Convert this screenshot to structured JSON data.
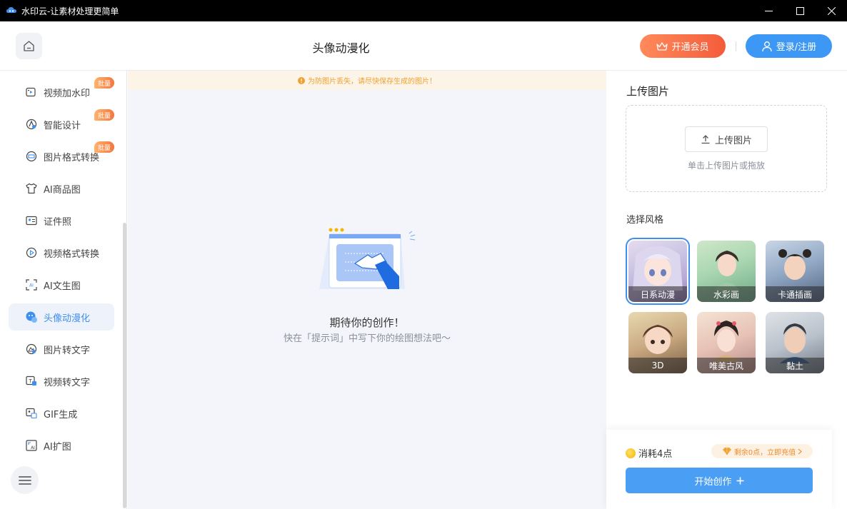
{
  "window": {
    "title": "水印云-让素材处理更简单",
    "controls": [
      "minimize-icon",
      "maximize-icon",
      "close-icon"
    ]
  },
  "header": {
    "title": "头像动漫化",
    "vip_label": "开通会员",
    "login_label": "登录/注册"
  },
  "sidebar": {
    "items": [
      {
        "label": "视频加水印",
        "icon": "video-watermark-icon",
        "badge": "批量",
        "active": false
      },
      {
        "label": "智能设计",
        "icon": "smart-design-icon",
        "badge": "批量",
        "active": false
      },
      {
        "label": "图片格式转换",
        "icon": "image-format-icon",
        "badge": "批量",
        "active": false
      },
      {
        "label": "AI商品图",
        "icon": "tshirt-icon",
        "badge": "",
        "active": false
      },
      {
        "label": "证件照",
        "icon": "id-photo-icon",
        "badge": "",
        "active": false
      },
      {
        "label": "视频格式转换",
        "icon": "video-format-icon",
        "badge": "",
        "active": false
      },
      {
        "label": "AI文生图",
        "icon": "text-to-image-icon",
        "badge": "",
        "active": false
      },
      {
        "label": "头像动漫化",
        "icon": "avatar-anime-icon",
        "badge": "",
        "active": true
      },
      {
        "label": "图片转文字",
        "icon": "image-to-text-icon",
        "badge": "",
        "active": false
      },
      {
        "label": "视频转文字",
        "icon": "video-to-text-icon",
        "badge": "",
        "active": false
      },
      {
        "label": "GIF生成",
        "icon": "gif-icon",
        "badge": "",
        "active": false
      },
      {
        "label": "AI扩图",
        "icon": "ai-expand-icon",
        "badge": "",
        "active": false
      }
    ]
  },
  "main": {
    "notice": "为防图片丢失，请尽快保存生成的图片！",
    "empty_title": "期待你的创作！",
    "empty_subtitle": "快在「提示词」中写下你的绘图想法吧～"
  },
  "right": {
    "upload_title": "上传图片",
    "upload_button": "上传图片",
    "upload_hint": "单击上传图片或拖放",
    "style_title": "选择风格",
    "styles": [
      {
        "label": "日系动漫",
        "selected": true
      },
      {
        "label": "水彩画",
        "selected": false
      },
      {
        "label": "卡通插画",
        "selected": false
      },
      {
        "label": "3D",
        "selected": false
      },
      {
        "label": "唯美古风",
        "selected": false
      },
      {
        "label": "黏土",
        "selected": false
      }
    ],
    "cost": "消耗4点",
    "balance": "剩余0点，立即充值",
    "start_button": "开始创作"
  },
  "colors": {
    "accent": "#3d8ff0",
    "vip_orange": "#f45b3a",
    "notice_text": "#f0a030"
  }
}
